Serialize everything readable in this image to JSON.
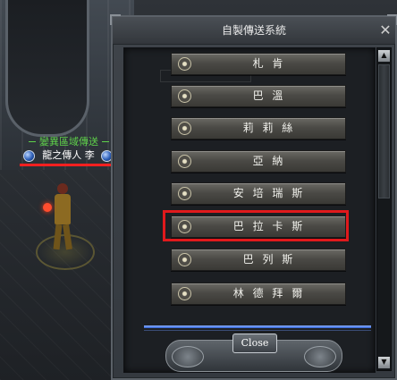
{
  "window": {
    "title": "自製傳送系統",
    "close_x": "✕",
    "close_label": "Close"
  },
  "destinations": [
    {
      "label": "札 肯",
      "highlighted": false
    },
    {
      "label": "巴 溫",
      "highlighted": false
    },
    {
      "label": "莉 莉 絲",
      "highlighted": false
    },
    {
      "label": "亞 納",
      "highlighted": false
    },
    {
      "label": "安 培 瑞 斯",
      "highlighted": false
    },
    {
      "label": "巴 拉 卡 斯",
      "highlighted": true
    },
    {
      "label": "巴 列 斯",
      "highlighted": false
    },
    {
      "label": "林 德 拜 爾",
      "highlighted": false
    }
  ],
  "npc": {
    "title": "變異區域傳送",
    "name": "龍之傳人 李"
  },
  "scrollbar": {
    "up_arrow": "▲",
    "down_arrow": "▼"
  },
  "colors": {
    "npc_title": "#5fd24a",
    "highlight": "#e0191c",
    "accent_line": "#2f5fd0"
  },
  "icons": {
    "button_icon": "compass-emblem-icon",
    "npc_orb": "blue-orb-icon"
  }
}
